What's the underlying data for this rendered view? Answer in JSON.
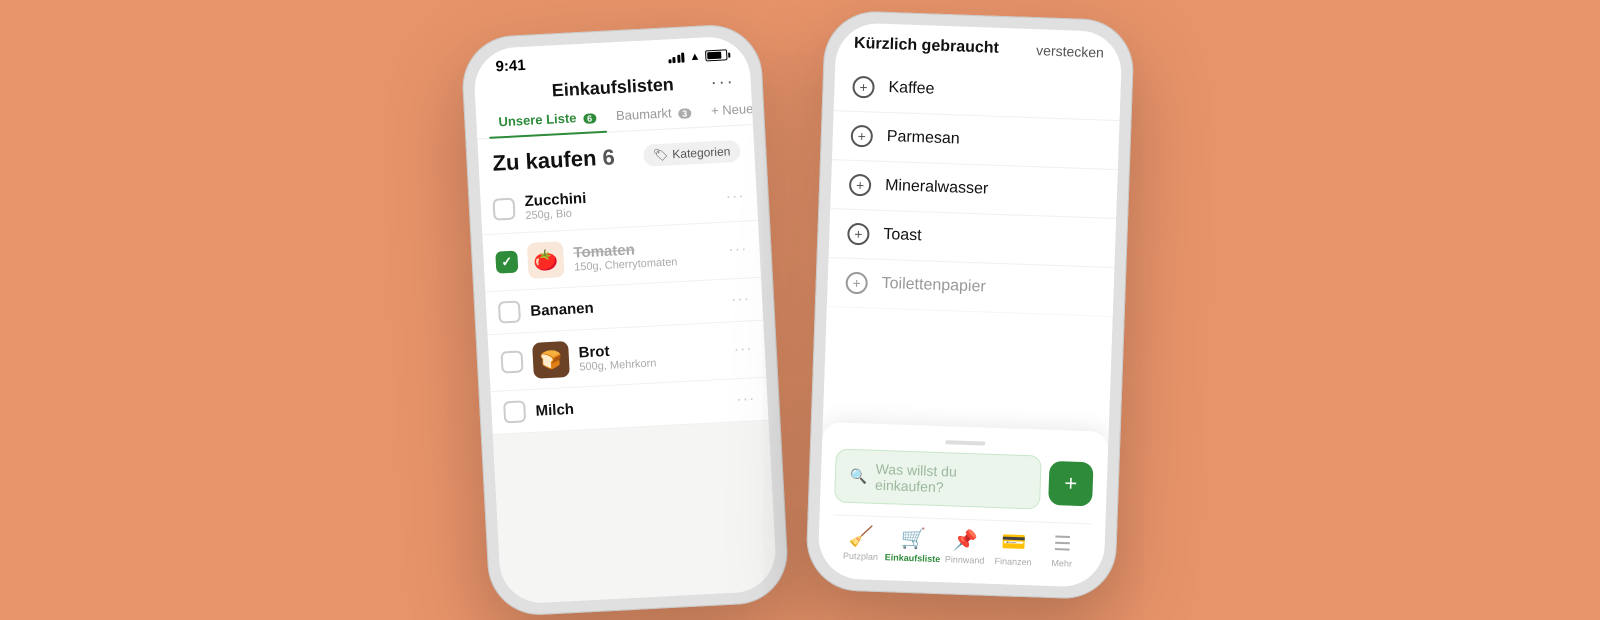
{
  "background": "#E8946A",
  "phone1": {
    "time": "9:41",
    "header": {
      "title": "Einkaufslisten",
      "dots_label": "···"
    },
    "tabs": [
      {
        "label": "Unsere Liste",
        "badge": "6",
        "active": true
      },
      {
        "label": "Baumarkt",
        "badge": "3",
        "active": false
      },
      {
        "label": "+ Neue Liste",
        "badge": "",
        "active": false
      }
    ],
    "list_header": {
      "title": "Zu kaufen",
      "count": "6",
      "categories_btn": "Kategorien"
    },
    "items": [
      {
        "name": "Zucchini",
        "sub": "250g, Bio",
        "checked": false,
        "has_thumb": false,
        "thumb_type": ""
      },
      {
        "name": "Tomaten",
        "sub": "150g, Cherrytomaten",
        "checked": true,
        "has_thumb": true,
        "thumb_type": "tomato"
      },
      {
        "name": "Bananen",
        "sub": "",
        "checked": false,
        "has_thumb": false,
        "thumb_type": ""
      },
      {
        "name": "Brot",
        "sub": "500g, Mehrkorn",
        "checked": false,
        "has_thumb": true,
        "thumb_type": "bread"
      },
      {
        "name": "Milch",
        "sub": "",
        "checked": false,
        "has_thumb": false,
        "thumb_type": ""
      }
    ]
  },
  "phone2": {
    "recently_title": "Kürzlich gebraucht",
    "hide_btn": "verstecken",
    "recent_items": [
      {
        "name": "Kaffee"
      },
      {
        "name": "Parmesan"
      },
      {
        "name": "Mineralwasser"
      },
      {
        "name": "Toast"
      },
      {
        "name": "Toilettenpapier",
        "partial": true
      }
    ],
    "search_placeholder": "Was willst du einkaufen?",
    "add_btn_label": "+",
    "nav_items": [
      {
        "label": "Putzplan",
        "icon": "🧹",
        "active": false
      },
      {
        "label": "Einkaufsliste",
        "icon": "🛒",
        "active": true
      },
      {
        "label": "Pinnwand",
        "icon": "📌",
        "active": false
      },
      {
        "label": "Finanzen",
        "icon": "💳",
        "active": false
      },
      {
        "label": "Mehr",
        "icon": "☰",
        "active": false
      }
    ]
  }
}
